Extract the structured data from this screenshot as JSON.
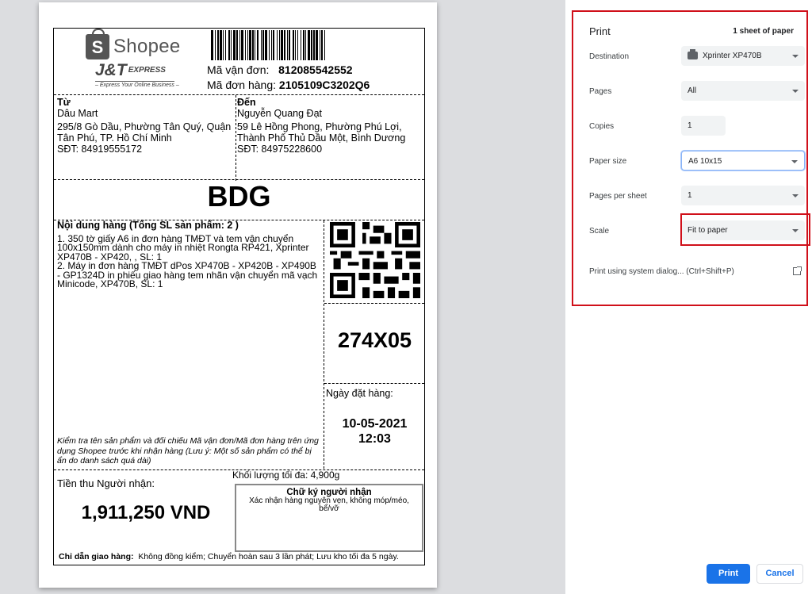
{
  "label": {
    "logos": {
      "shopee_text": "Shopee",
      "shopee_bag_letter": "S",
      "jt_main": "J&T",
      "jt_sub": "EXPRESS",
      "jt_tagline": "– Express Your Online Business –"
    },
    "tracking_label": "Mã vận đơn:",
    "tracking_number": "812085542552",
    "order_label": "Mã đơn hàng:",
    "order_number": "2105109C3202Q6",
    "sender": {
      "heading": "Từ",
      "name": "Dâu Mart",
      "address": "295/8 Gò Dầu, Phường Tân Quý, Quận Tân Phú, TP. Hồ Chí Minh",
      "phone": "SĐT: 84919555172"
    },
    "recipient": {
      "heading": "Đến",
      "name": "Nguyễn Quang Đạt",
      "address": "59 Lê Hồng Phong, Phường Phú Lợi, Thành Phố Thủ Dầu Một, Bình Dương",
      "phone": "SĐT: 84975228600"
    },
    "route_code": "BDG",
    "goods_title": "Nội dung hàng (Tổng SL sản phẩm: 2 )",
    "goods_item_1": "1. 350 tờ giấy A6 in đơn hàng TMĐT và tem vận chuyển 100x150mm dành cho máy in nhiệt Rongta RP421, Xprinter XP470B - XP420, , SL: 1",
    "goods_item_2": "2. Máy in đơn hàng TMĐT dPos XP470B - XP420B - XP490B - GP1324D in phiếu giao hàng tem nhãn vận chuyển mã vạch Minicode, XP470B, SL: 1",
    "goods_note": "Kiểm tra tên sản phẩm và đối chiếu Mã vận đơn/Mã đơn hàng trên ứng dụng Shopee trước khi nhận hàng (Lưu ý: Một số sản phẩm có thể bị ẩn do danh sách quá dài)",
    "sort_code": "274X05",
    "order_date_label": "Ngày đặt hàng:",
    "order_date": "10-05-2021",
    "order_time": "12:03",
    "weight": "Khối lượng tối đa: 4,900g",
    "cod_label": "Tiền thu Người nhận:",
    "cod_amount": "1,911,250 VND",
    "signature_title": "Chữ ký người nhận",
    "signature_text": "Xác nhận hàng nguyên vẹn, không móp/méo, bể/vỡ",
    "instructions_label": "Chỉ dẫn giao hàng:",
    "instructions_text": "Không đồng kiểm; Chuyển hoàn sau 3 lần phát; Lưu kho tối đa 5 ngày."
  },
  "print_panel": {
    "title": "Print",
    "sheet_count": "1 sheet of paper",
    "destination_label": "Destination",
    "destination_value": "Xprinter XP470B",
    "pages_label": "Pages",
    "pages_value": "All",
    "copies_label": "Copies",
    "copies_value": "1",
    "paper_size_label": "Paper size",
    "paper_size_value": "A6 10x15",
    "pages_per_sheet_label": "Pages per sheet",
    "pages_per_sheet_value": "1",
    "scale_label": "Scale",
    "scale_value": "Fit to paper",
    "system_dialog": "Print using system dialog... (Ctrl+Shift+P)",
    "print_button": "Print",
    "cancel_button": "Cancel"
  },
  "colors": {
    "highlight": "#d0101a",
    "primary": "#1a73e8"
  }
}
